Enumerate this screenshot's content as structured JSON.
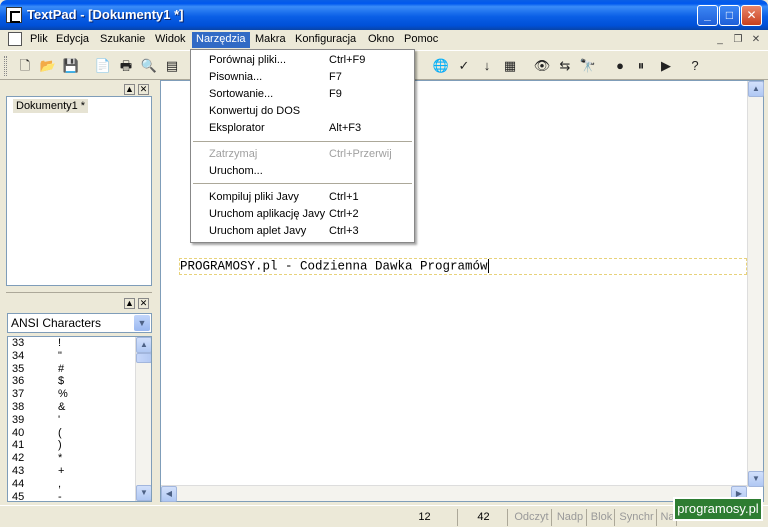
{
  "window": {
    "title": "TextPad - [Dokumenty1 *]"
  },
  "menubar": {
    "items": [
      "Plik",
      "Edycja",
      "Szukanie",
      "Widok",
      "Narzędzia",
      "Makra",
      "Konfiguracja",
      "Okno",
      "Pomoc"
    ],
    "active": "Narzędzia"
  },
  "dropdown": {
    "items": [
      {
        "label": "Porównaj pliki...",
        "shortcut": "Ctrl+F9"
      },
      {
        "label": "Pisownia...",
        "shortcut": "F7"
      },
      {
        "label": "Sortowanie...",
        "shortcut": "F9"
      },
      {
        "label": "Konwertuj do DOS",
        "shortcut": ""
      },
      {
        "label": "Eksplorator",
        "shortcut": "Alt+F3"
      },
      {
        "label": "Zatrzymaj",
        "shortcut": "Ctrl+Przerwij",
        "disabled": true
      },
      {
        "label": "Uruchom...",
        "shortcut": ""
      },
      {
        "label": "Kompiluj pliki Javy",
        "shortcut": "Ctrl+1"
      },
      {
        "label": "Uruchom aplikację Javy",
        "shortcut": "Ctrl+2"
      },
      {
        "label": "Uruchom aplet Javy",
        "shortcut": "Ctrl+3"
      }
    ]
  },
  "documents": {
    "tab_label": "Dokumenty1 *"
  },
  "charpanel": {
    "combo_value": "ANSI Characters",
    "rows": [
      {
        "code": "33",
        "ch": "!"
      },
      {
        "code": "34",
        "ch": "\""
      },
      {
        "code": "35",
        "ch": "#"
      },
      {
        "code": "36",
        "ch": "$"
      },
      {
        "code": "37",
        "ch": "%"
      },
      {
        "code": "38",
        "ch": "&"
      },
      {
        "code": "39",
        "ch": "'"
      },
      {
        "code": "40",
        "ch": "("
      },
      {
        "code": "41",
        "ch": ")"
      },
      {
        "code": "42",
        "ch": "*"
      },
      {
        "code": "43",
        "ch": "+"
      },
      {
        "code": "44",
        "ch": ","
      },
      {
        "code": "45",
        "ch": "-"
      }
    ]
  },
  "editor": {
    "line_text": "PROGRAMOSY.pl - Codzienna Dawka Programów"
  },
  "statusbar": {
    "line": "12",
    "column": "42",
    "flags": [
      "Odczyt",
      "Nadp",
      "Blok",
      "Synchr",
      "Na"
    ]
  },
  "watermark": "programosy.pl"
}
